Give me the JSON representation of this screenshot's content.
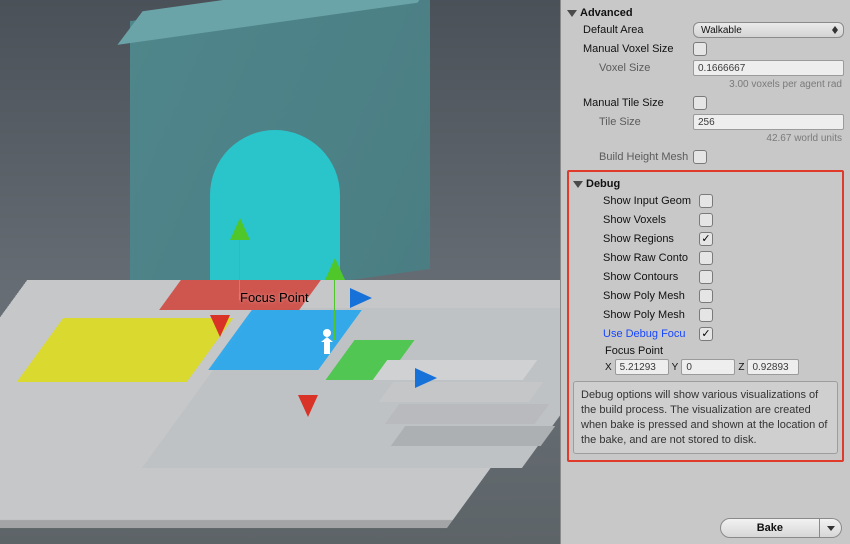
{
  "scene": {
    "focus_label": "Focus Point"
  },
  "inspector": {
    "advanced": {
      "header": "Advanced",
      "default_area": {
        "label": "Default Area",
        "value": "Walkable"
      },
      "manual_voxel": {
        "label": "Manual Voxel Size",
        "checked": false
      },
      "voxel_size": {
        "label": "Voxel Size",
        "value": "0.1666667"
      },
      "voxel_helper": "3.00 voxels per agent rad",
      "manual_tile": {
        "label": "Manual Tile Size",
        "checked": false
      },
      "tile_size": {
        "label": "Tile Size",
        "value": "256"
      },
      "tile_helper": "42.67 world units",
      "height_mesh": {
        "label": "Build Height Mesh",
        "checked": false
      }
    },
    "debug": {
      "header": "Debug",
      "items": [
        {
          "label": "Show Input Geom",
          "checked": false
        },
        {
          "label": "Show Voxels",
          "checked": false
        },
        {
          "label": "Show Regions",
          "checked": true
        },
        {
          "label": "Show Raw Conto",
          "checked": false
        },
        {
          "label": "Show Contours",
          "checked": false
        },
        {
          "label": "Show Poly Mesh",
          "checked": false
        },
        {
          "label": "Show Poly Mesh",
          "checked": false
        },
        {
          "label": "Use Debug Focu",
          "checked": true,
          "highlight": true
        }
      ],
      "focus_point": {
        "label": "Focus Point",
        "x": "5.21293",
        "y": "0",
        "z": "0.92893"
      },
      "info": "Debug options will show various visualizations of the build process. The visualization are created when bake is pressed and shown at the location of the bake, and are not stored to disk."
    },
    "bake_label": "Bake"
  }
}
